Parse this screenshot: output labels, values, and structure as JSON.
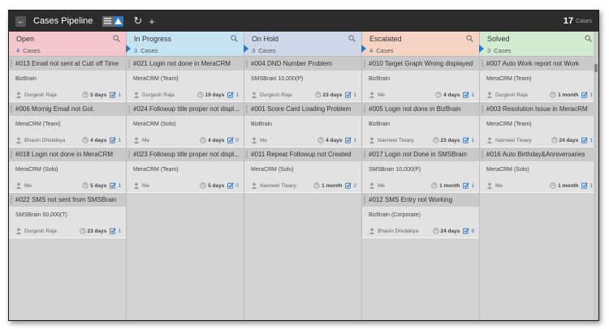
{
  "app": {
    "title": "Cases Pipeline",
    "count": "17",
    "count_label": "Cases"
  },
  "icons": {
    "back": "back-arrow-icon",
    "list_view": "list-view-icon",
    "pipeline_view": "pipeline-view-icon",
    "refresh": "refresh-icon",
    "add": "add-icon",
    "zoom": "zoom-icon",
    "user": "user-icon",
    "clock": "clock-icon",
    "check": "check-icon"
  },
  "colors": {
    "accent": "#2c79c2",
    "open": "#f4c7cd",
    "in_progress": "#c6e3f2",
    "on_hold": "#cfd8e9",
    "escalated": "#f6d4c4",
    "solved": "#d3ecd1"
  },
  "columns": [
    {
      "title": "Open",
      "count": "4",
      "count_label": "Cases",
      "color": "#f4c7cd",
      "cards": [
        {
          "title": "#013 Email not sent at Cutt off Time",
          "company": "BizBrain",
          "owner": "Durgesh Raja",
          "age": "5 days",
          "tasks": "1"
        },
        {
          "title": "#006 Mornig Email not Got.",
          "company": "MeraCRM (Team)",
          "owner": "Bhavin Dholakiya",
          "age": "4 days",
          "tasks": "1"
        },
        {
          "title": "#018 Login not done in MeraCRM",
          "company": "MeraCRM (Solo)",
          "owner": "Me",
          "age": "5 days",
          "tasks": "1"
        },
        {
          "title": "#022 SMS not sent from SMSBrain",
          "company": "SMSBrain 50,000(T)",
          "owner": "Durgesh Raja",
          "age": "23 days",
          "tasks": "1"
        }
      ]
    },
    {
      "title": "In Progress",
      "count": "3",
      "count_label": "Cases",
      "color": "#c6e3f2",
      "cards": [
        {
          "title": "#021 Login not done in MeraCRM",
          "company": "MeraCRM (Team)",
          "owner": "Durgesh Raja",
          "age": "19 days",
          "tasks": "1"
        },
        {
          "title": "#024 Followup title proper not displ...",
          "company": "MeraCRM (Solo)",
          "owner": "Me",
          "age": "4 days",
          "tasks": "0"
        },
        {
          "title": "#023 Followup title proper not displ...",
          "company": "MeraCRM (Team)",
          "owner": "Me",
          "age": "5 days",
          "tasks": "0"
        }
      ]
    },
    {
      "title": "On Hold",
      "count": "3",
      "count_label": "Cases",
      "color": "#cfd8e9",
      "cards": [
        {
          "title": "#004 DND Number Problem",
          "company": "SMSBrain 10,000(P)",
          "owner": "Durgesh Raja",
          "age": "23 days",
          "tasks": "1"
        },
        {
          "title": "#001 Score Card Loading Problem",
          "company": "BizBrain",
          "owner": "Me",
          "age": "4 days",
          "tasks": "1"
        },
        {
          "title": "#011 Repeat Followup not Created",
          "company": "MeraCRM (Solo)",
          "owner": "Navneet Tiwary",
          "age": "1 month",
          "tasks": "2"
        }
      ]
    },
    {
      "title": "Escalated",
      "count": "4",
      "count_label": "Cases",
      "color": "#f6d4c4",
      "cards": [
        {
          "title": "#010 Target Graph Wrong displayed",
          "company": "BizBrain",
          "owner": "Me",
          "age": "4 days",
          "tasks": "1"
        },
        {
          "title": "#005 Login not done in BizBrain",
          "company": "BizBrain",
          "owner": "Navneet Tiwary",
          "age": "23 days",
          "tasks": "1"
        },
        {
          "title": "#017 Login not Done in SMSBrain",
          "company": "SMSBrain 10,000(P)",
          "owner": "Me",
          "age": "1 month",
          "tasks": "1"
        },
        {
          "title": "#012 SMS Entry not Working",
          "company": "BizBrain (Corporate)",
          "owner": "Bhavin Dholakiya",
          "age": "24 days",
          "tasks": "6"
        }
      ]
    },
    {
      "title": "Solved",
      "count": "3",
      "count_label": "Cases",
      "color": "#d3ecd1",
      "cards": [
        {
          "title": "#007 Auto Work report not Work",
          "company": "MeraCRM (Team)",
          "owner": "Durgesh Raja",
          "age": "1 month",
          "tasks": "1"
        },
        {
          "title": "#003 Resolution Issue in MeracRM",
          "company": "MeraCRM (Team)",
          "owner": "Navneet Tiwary",
          "age": "24 days",
          "tasks": "1"
        },
        {
          "title": "#016 Auto Birthday&Anniversaries",
          "company": "MeraCRM (Solo)",
          "owner": "Me",
          "age": "1 month",
          "tasks": "1"
        }
      ]
    }
  ]
}
